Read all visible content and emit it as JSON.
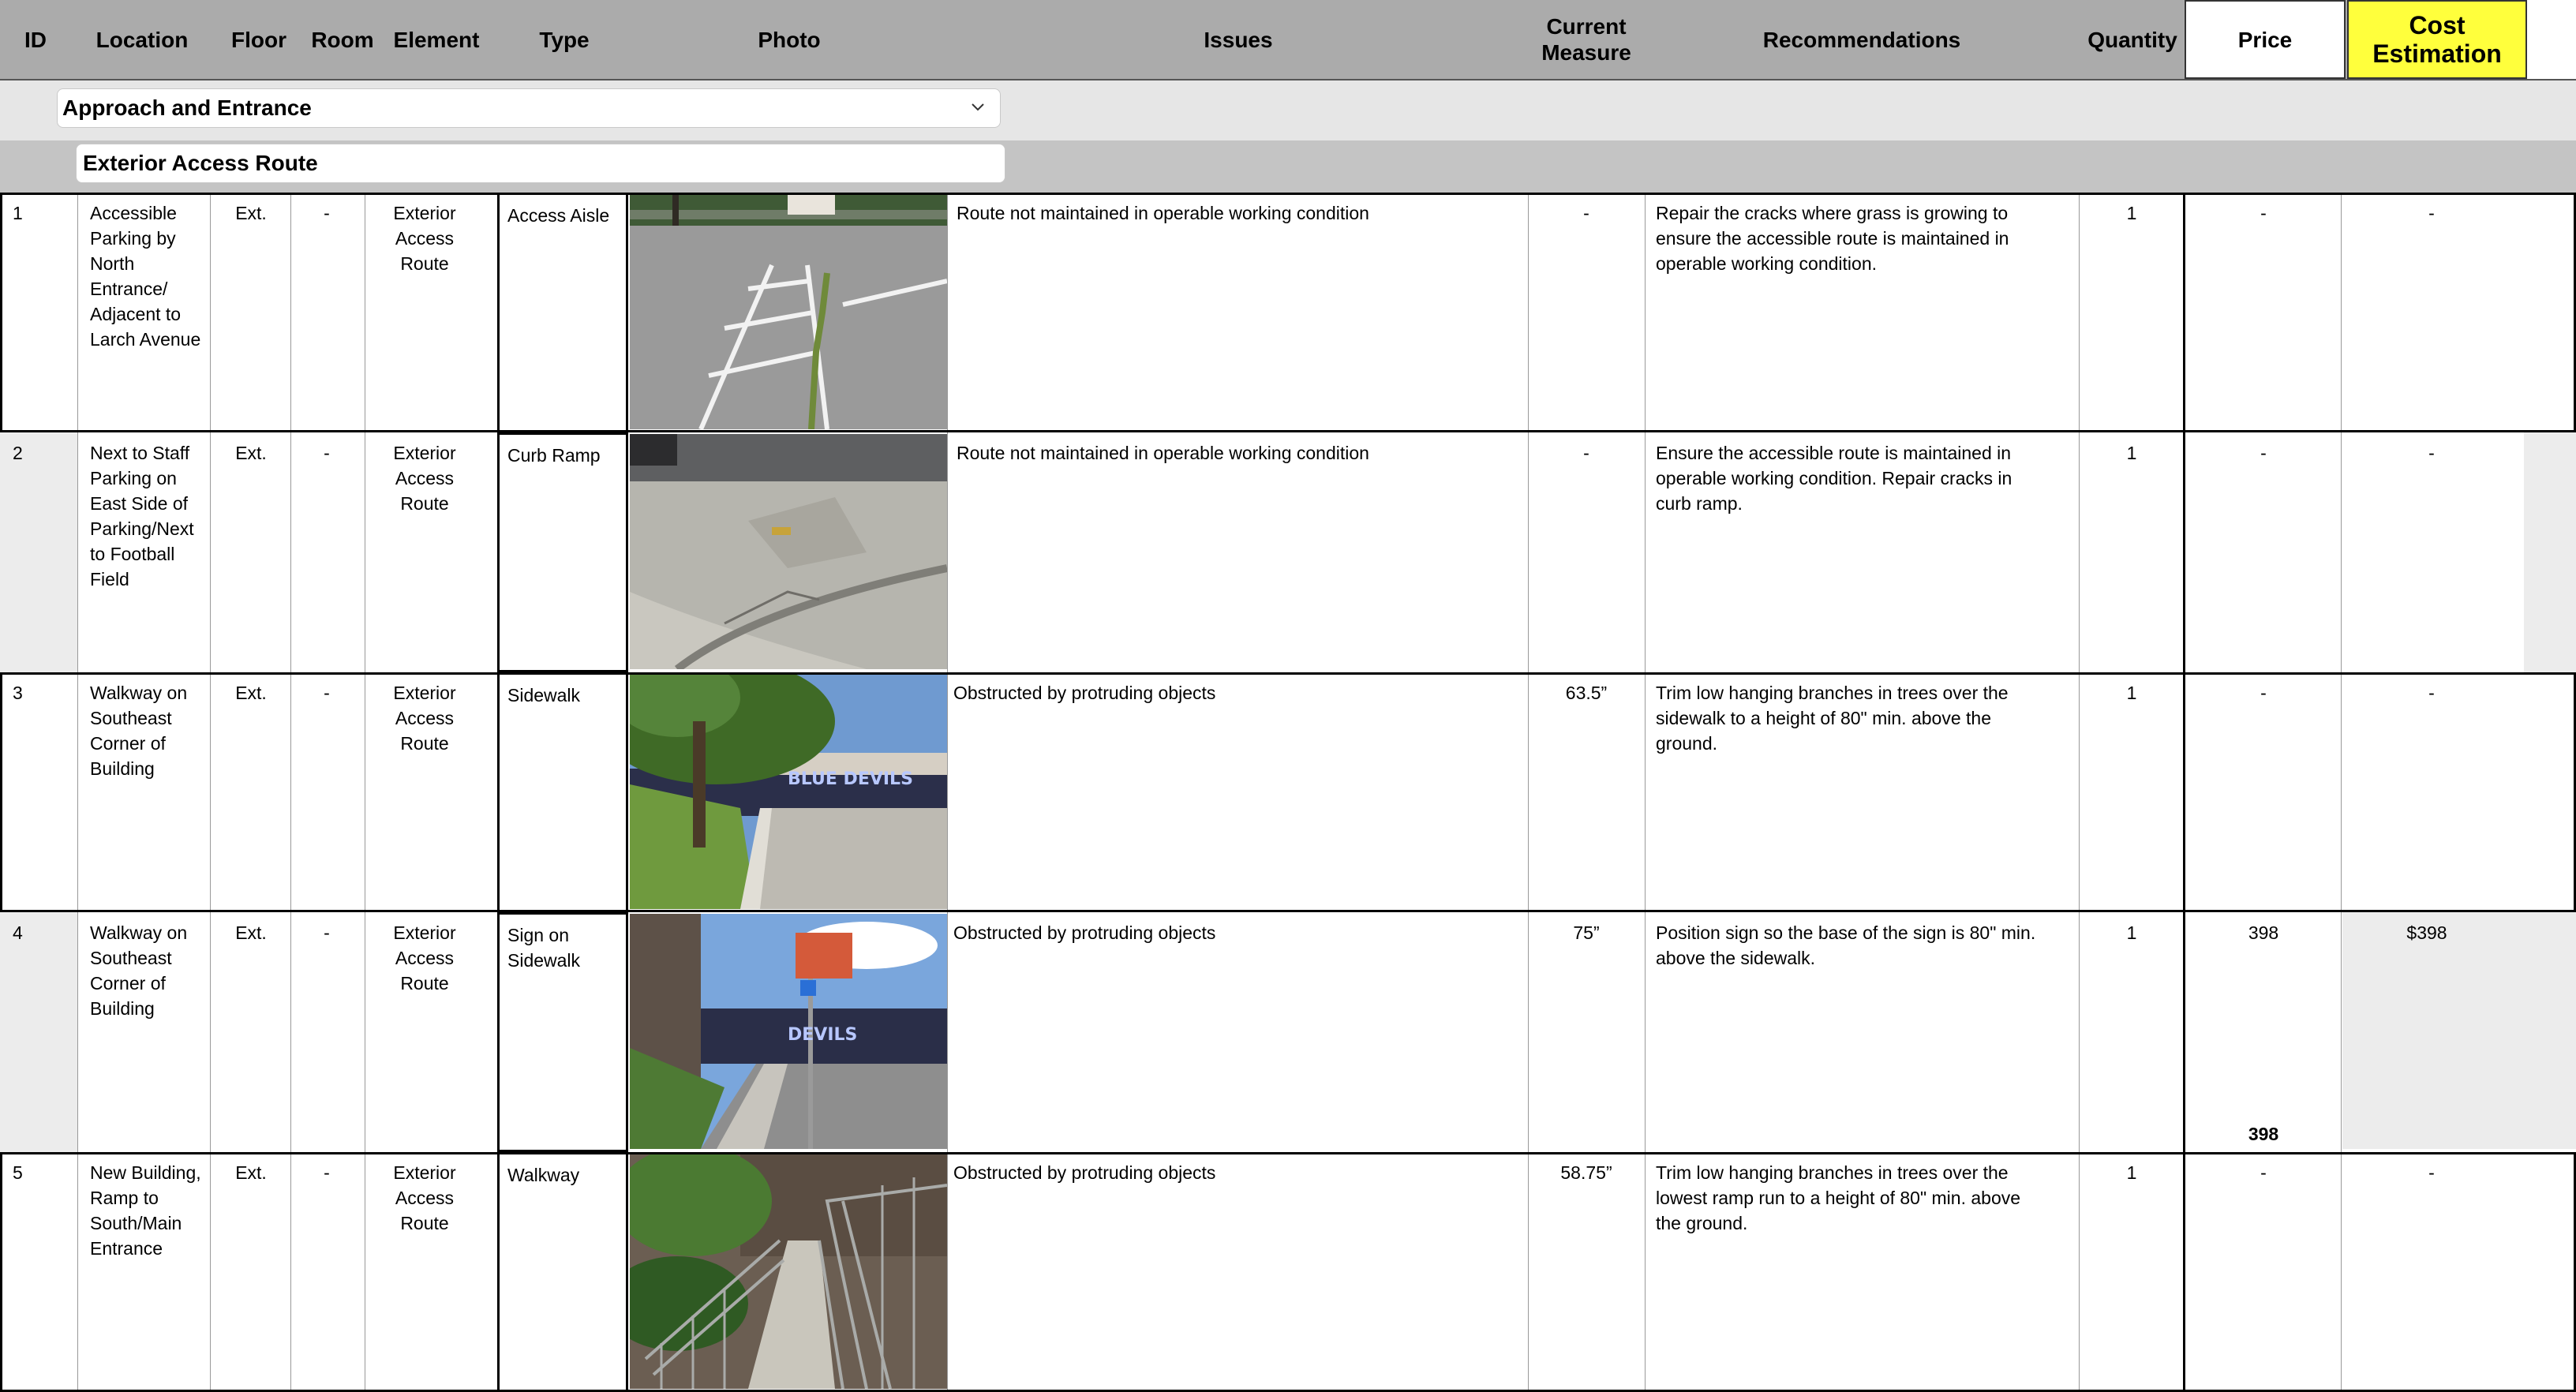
{
  "header": {
    "columns": [
      "ID",
      "Location",
      "Floor",
      "Room",
      "Element",
      "Type",
      "Photo",
      "Issues",
      "Current Measure",
      "Recommendations",
      "Quantity",
      "Price",
      "Cost Estimation"
    ],
    "current_measure_l1": "Current",
    "current_measure_l2": "Measure",
    "cost_l1": "Cost",
    "cost_l2": "Estimation",
    "cost_color": "#ffff3c"
  },
  "category_select": {
    "value": "Approach and Entrance"
  },
  "section": {
    "value": "Exterior Access Route"
  },
  "rows": [
    {
      "id": "1",
      "location": "Accessible Parking by North Entrance/ Adjacent to Larch Avenue",
      "floor": "Ext.",
      "room": "-",
      "element": "Exterior Access Route",
      "type": "Access Aisle",
      "photo": "parking-lot-cracks",
      "issues": "Route not maintained in operable working condition",
      "measure": "-",
      "recommendation": "Repair the cracks where grass is growing to ensure the accessible route is maintained in operable working condition.",
      "quantity": "1",
      "price": "-",
      "cost": "-"
    },
    {
      "id": "2",
      "location": "Next to Staff Parking on East Side of Parking/Next to Football Field",
      "floor": "Ext.",
      "room": "-",
      "element": "Exterior Access Route",
      "type": "Curb Ramp",
      "photo": "cracked-curb-ramp",
      "issues": "Route not maintained in operable working condition",
      "measure": "-",
      "recommendation": "Ensure the accessible route is maintained in operable working condition. Repair cracks in curb ramp.",
      "quantity": "1",
      "price": "-",
      "cost": "-"
    },
    {
      "id": "3",
      "location": "Walkway on Southeast Corner of Building",
      "floor": "Ext.",
      "room": "-",
      "element": "Exterior Access Route",
      "type": "Sidewalk",
      "photo": "tree-over-sidewalk",
      "issues": "Obstructed by protruding objects",
      "measure": "63.5”",
      "recommendation": "Trim low hanging branches in trees over the sidewalk to a height of 80\" min. above the ground.",
      "quantity": "1",
      "price": "-",
      "cost": "-"
    },
    {
      "id": "4",
      "location": "Walkway on Southeast Corner of Building",
      "floor": "Ext.",
      "room": "-",
      "element": "Exterior Access Route",
      "type": "Sign on Sidewalk",
      "photo": "sign-on-sidewalk",
      "issues": "Obstructed by protruding objects",
      "measure": "75”",
      "recommendation": "Position sign so the base of the sign is 80\" min. above the sidewalk.",
      "quantity": "1",
      "price": "398",
      "cost": "$398",
      "price_total": "398"
    },
    {
      "id": "5",
      "location": "New Building, Ramp to South/Main Entrance",
      "floor": "Ext.",
      "room": "-",
      "element": "Exterior Access Route",
      "type": "Walkway",
      "photo": "ramp-with-railings",
      "issues": "Obstructed by protruding objects",
      "measure": "58.75”",
      "recommendation": "Trim low hanging branches in trees over the lowest ramp run to a height of 80\" min. above the ground.",
      "quantity": "1",
      "price": "-",
      "cost": "-"
    }
  ]
}
